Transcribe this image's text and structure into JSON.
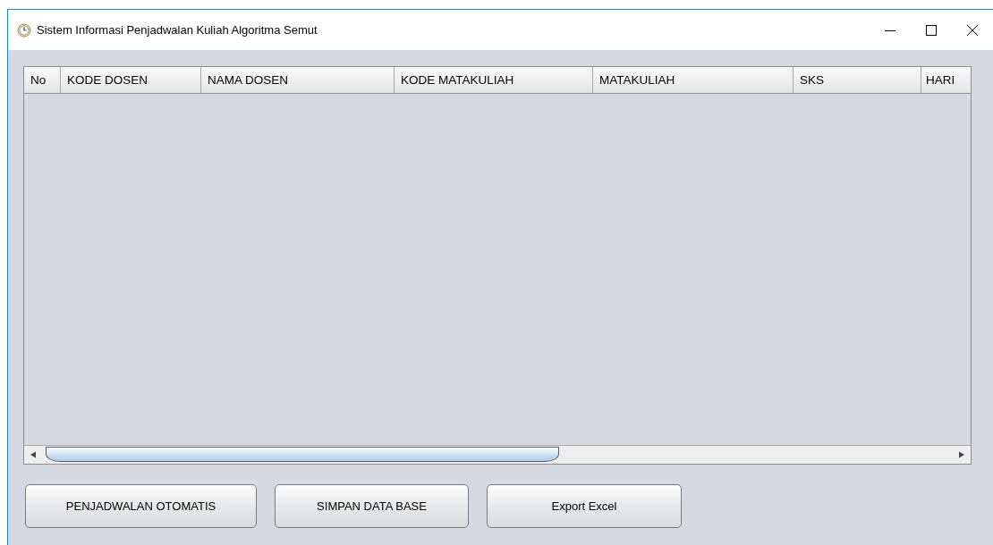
{
  "window": {
    "title": "Sistem Informasi Penjadwalan Kuliah Algoritma Semut"
  },
  "table": {
    "columns": [
      {
        "label": "No"
      },
      {
        "label": "KODE DOSEN"
      },
      {
        "label": "NAMA DOSEN"
      },
      {
        "label": "KODE MATAKULIAH"
      },
      {
        "label": "MATAKULIAH"
      },
      {
        "label": "SKS"
      },
      {
        "label": "HARI"
      }
    ]
  },
  "buttons": [
    {
      "label": "PENJADWALAN OTOMATIS"
    },
    {
      "label": "SIMPAN DATA BASE"
    },
    {
      "label": "Export Excel"
    }
  ]
}
